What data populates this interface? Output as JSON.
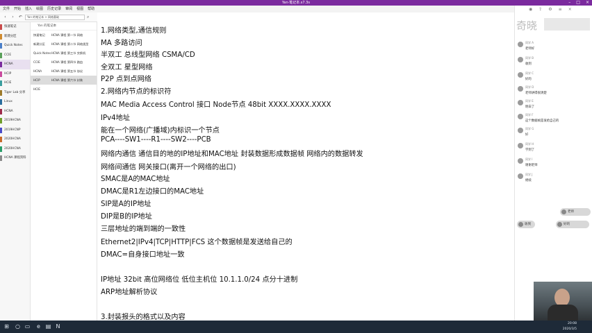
{
  "window": {
    "title": "Yan·笔记本.s7.3s"
  },
  "menu": [
    "文件",
    "开始",
    "插入",
    "绘图",
    "历史记录",
    "审阅",
    "视图",
    "帮助"
  ],
  "breadcrumb": "Yan 的笔记本 > 网络基础",
  "sections": [
    {
      "label": "快速笔记",
      "color": "#c94a4a"
    },
    {
      "label": "新建分区",
      "color": "#d08a2e"
    },
    {
      "label": "Quick Notes",
      "color": "#4a7fc9"
    },
    {
      "label": "CCIE",
      "color": "#5aa05a"
    },
    {
      "label": "HCNA",
      "color": "#7b2a9e"
    },
    {
      "label": "HCIP",
      "color": "#c94a9e"
    },
    {
      "label": "HCIE",
      "color": "#3a9e9e"
    },
    {
      "label": "Tiger Lab 分享",
      "color": "#9e7b2a"
    },
    {
      "label": "Linux",
      "color": "#2a6e9e"
    },
    {
      "label": "HCNA",
      "color": "#9e2a4a"
    },
    {
      "label": "2019HCNA",
      "color": "#6e9e2a"
    },
    {
      "label": "2019HCNP",
      "color": "#4a4ac9"
    },
    {
      "label": "2020HCNA",
      "color": "#c96a2a"
    },
    {
      "label": "2020HCNA",
      "color": "#2a9e6a"
    },
    {
      "label": "HCNA 课程资料",
      "color": "#8a8a8a"
    }
  ],
  "pages_header": "Yan 的笔记本",
  "pages": [
    {
      "c1": "快速笔记",
      "c2": "HCNA 课程 第一节 网络"
    },
    {
      "c1": "新建分区",
      "c2": "HCNA 课程 第二节 网络类型"
    },
    {
      "c1": "Quick Notes",
      "c2": "HCNA 课程 第三节 交换机"
    },
    {
      "c1": "CCIE",
      "c2": "HCNA 课程 第四节 路由"
    },
    {
      "c1": "HCNA",
      "c2": "HCNA 课程 第五节 协议"
    },
    {
      "c1": "HCIP",
      "c2": "HCNA 课程 第六节 封装"
    },
    {
      "c1": "HCIE",
      "c2": ""
    }
  ],
  "note_lines": [
    "1.网络类型,通信规则",
    "MA 多路访问",
    "半双工  总线型网络 CSMA/CD",
    "全双工  星型网络",
    "P2P 点到点网络",
    "2.网络内节点的标识符",
    "MAC Media Access Control 接口 Node节点 48bit  XXXX.XXXX.XXXX",
    "IPv4地址",
    "能在一个网络(广播域)内标识一个节点",
    "PCA----SW1----R1----SW2----PCB",
    "网络内通信 通信目的地的IP地址和MAC地址 封装数据形成数据帧 网络内的数据转发",
    "网络间通信  网关接口(离开一个网络的出口)",
    "SMAC是A的MAC地址",
    "DMAC是R1左边接口的MAC地址",
    "SIP是A的IP地址",
    "DIP是B的IP地址",
    "三层地址的端到端的一致性",
    "Ethernet2|IPv4|TCP|HTTP|FCS 这个数据帧是发送给自己的",
    "DMAC=自身接口地址一致",
    "",
    "IP地址  32bit  高位网络位  低位主机位  10.1.1.0/24 点分十进制",
    "ARP地址解析协议",
    "",
    "3.封装报头的格式以及内容"
  ],
  "chat": {
    "banner": "奇晓",
    "messages": [
      {
        "name": "同学 A",
        "text": "老师好"
      },
      {
        "name": "同学 B",
        "text": "收到"
      },
      {
        "name": "同学 C",
        "text": "好的"
      },
      {
        "name": "同学 D",
        "text": "老师讲得很清楚"
      },
      {
        "name": "同学 E",
        "text": "明白了"
      },
      {
        "name": "同学 F",
        "text": "这个数据帧是发给自己的"
      },
      {
        "name": "同学 G",
        "text": "好"
      },
      {
        "name": "同学 H",
        "text": "学到了"
      },
      {
        "name": "同学 I",
        "text": "谢谢老师"
      },
      {
        "name": "同学 J",
        "text": "继续"
      }
    ],
    "bubbles": [
      "老师",
      "收到",
      "好的"
    ]
  },
  "taskbar": {
    "time": "20:08",
    "date": "2020/3/5"
  }
}
